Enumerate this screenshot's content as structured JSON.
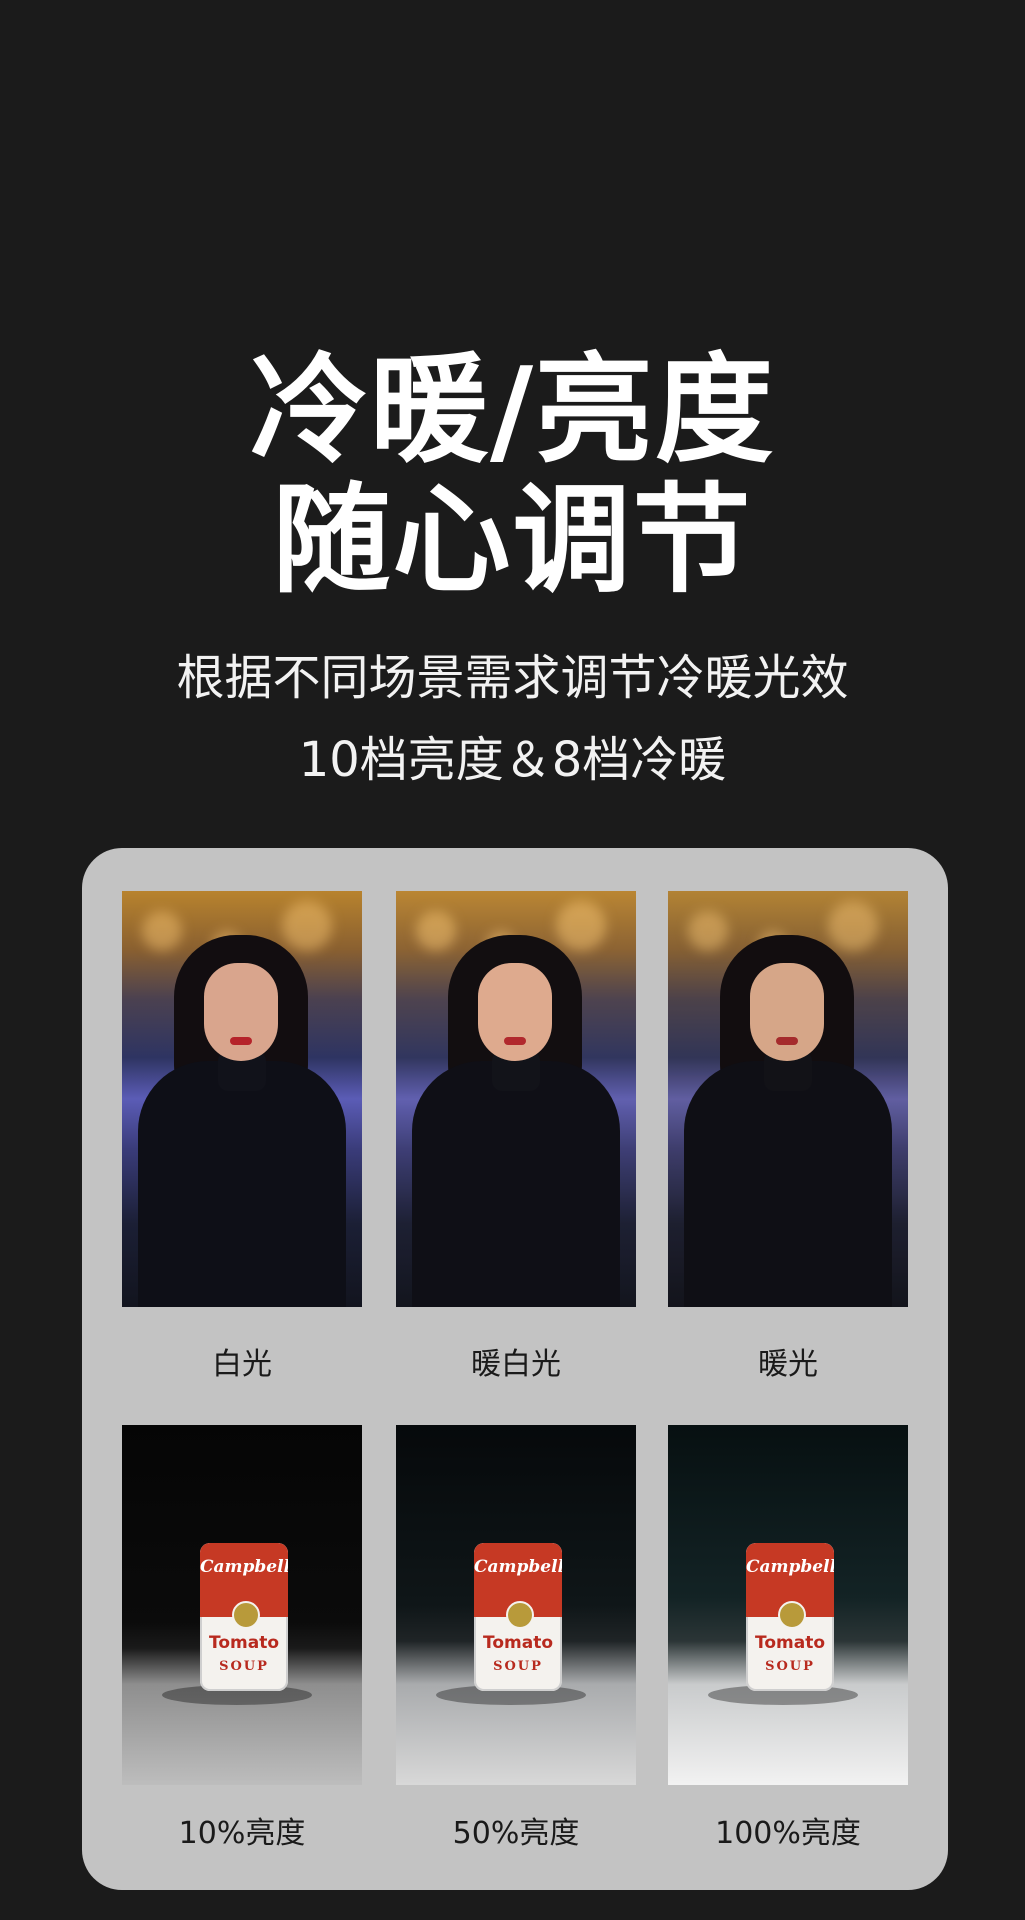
{
  "headline": {
    "line1": "冷暖/亮度",
    "line2": "随心调节"
  },
  "subtitle": {
    "line1": "根据不同场景需求调节冷暖光效",
    "line2": "10档亮度＆8档冷暖"
  },
  "color_temperature_samples": [
    {
      "label": "白光"
    },
    {
      "label": "暖白光"
    },
    {
      "label": "暖光"
    }
  ],
  "brightness_samples": [
    {
      "label": "10%亮度"
    },
    {
      "label": "50%亮度"
    },
    {
      "label": "100%亮度"
    }
  ],
  "can_label": {
    "brand": "Campbell's",
    "variety": "Tomato",
    "type": "SOUP"
  }
}
